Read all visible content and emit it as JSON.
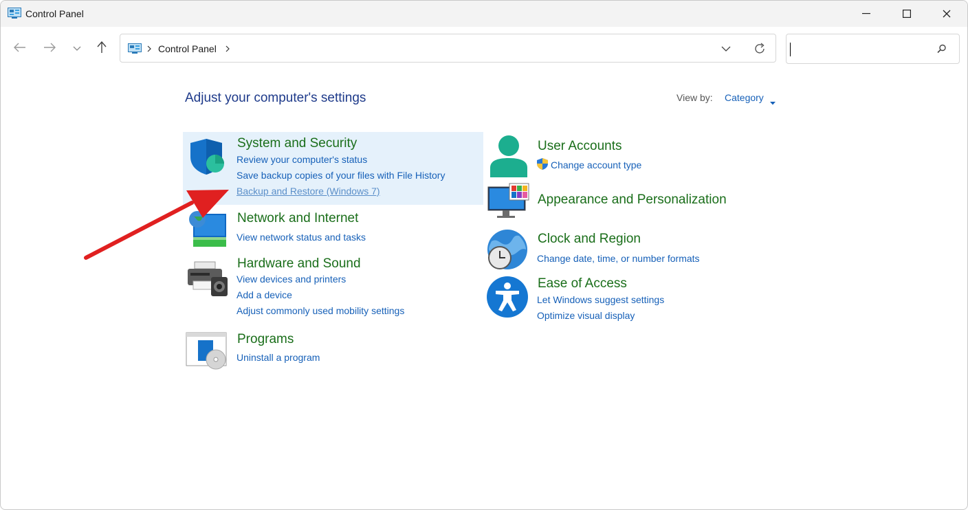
{
  "window": {
    "title": "Control Panel"
  },
  "address": {
    "crumb": "Control Panel"
  },
  "search": {
    "placeholder": ""
  },
  "header": {
    "title": "Adjust your computer's settings",
    "view_by_label": "View by:",
    "view_by_value": "Category"
  },
  "categories": {
    "system_security": {
      "title": "System and Security",
      "links": [
        "Review your computer's status",
        "Save backup copies of your files with File History",
        "Backup and Restore (Windows 7)"
      ]
    },
    "network": {
      "title": "Network and Internet",
      "links": [
        "View network status and tasks"
      ]
    },
    "hardware": {
      "title": "Hardware and Sound",
      "links": [
        "View devices and printers",
        "Add a device",
        "Adjust commonly used mobility settings"
      ]
    },
    "programs": {
      "title": "Programs",
      "links": [
        "Uninstall a program"
      ]
    },
    "user_accounts": {
      "title": "User Accounts",
      "links": [
        "Change account type"
      ]
    },
    "appearance": {
      "title": "Appearance and Personalization",
      "links": []
    },
    "clock": {
      "title": "Clock and Region",
      "links": [
        "Change date, time, or number formats"
      ]
    },
    "ease": {
      "title": "Ease of Access",
      "links": [
        "Let Windows suggest settings",
        "Optimize visual display"
      ]
    }
  },
  "colors": {
    "title_green": "#1a6e1a",
    "link_blue": "#1660b8",
    "highlight": "#e5f1fb",
    "arrow_red": "#e02020"
  },
  "icons": [
    "control-panel-icon",
    "back-arrow-icon",
    "forward-arrow-icon",
    "chevron-down-icon",
    "up-arrow-icon",
    "refresh-icon",
    "search-icon",
    "shield-icon",
    "network-icon",
    "printer-icon",
    "programs-icon",
    "user-icon",
    "uac-shield-icon",
    "monitor-palette-icon",
    "globe-clock-icon",
    "accessibility-icon"
  ]
}
